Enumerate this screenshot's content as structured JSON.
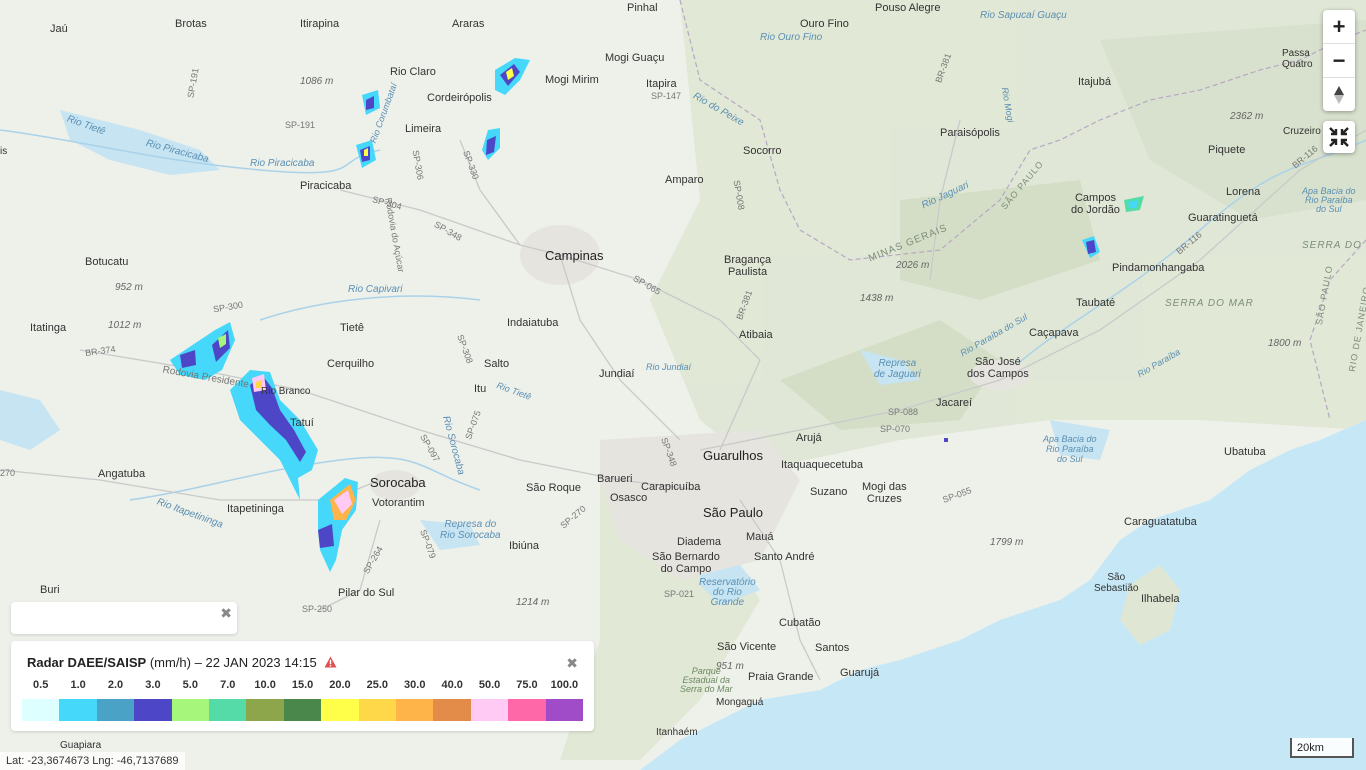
{
  "map": {
    "colors": {
      "land": "#eef0ea",
      "sea": "#c6e8f6",
      "lake": "#c6e4f2",
      "relief": "#d9e3cf",
      "road": "#c9c9c9",
      "border": "#b7a7c3"
    },
    "labels": {
      "jau": "Jaú",
      "brotas": "Brotas",
      "itirapina": "Itirapina",
      "araras": "Araras",
      "pinhal": "Pinhal",
      "mogi_guacu": "Mogi Guaçu",
      "ouro_fino": "Ouro Fino",
      "rio_ouro_fino": "Rio Ouro Fino",
      "pouso_alegre": "Pouso Alegre",
      "rio_sapucai": "Rio Sapucaí Guaçu",
      "passa_quatro": "Passa\nQuatro",
      "rio_claro": "Rio Claro",
      "mogi_mirim": "Mogi Mirim",
      "itapira": "Itapira",
      "itajuba": "Itajubá",
      "cordeiropolis": "Cordeirópolis",
      "elev_1086": "1086 m",
      "rio_tiete_1": "Rio Tietê",
      "rio_piracicaba_1": "Rio Piracicaba",
      "limeira": "Limeira",
      "rio_piracicaba_2": "Rio Piracicaba",
      "paraisopolis": "Paraisópolis",
      "cruzeiro": "Cruzeiro",
      "elev_2362": "2362 m",
      "socorro": "Socorro",
      "piquete": "Piquete",
      "piracicaba": "Piracicaba",
      "amparo": "Amparo",
      "lorena": "Lorena",
      "campos_jordao": "Campos\ndo Jordão",
      "guaratingueta": "Guaratinguetá",
      "apa_paraiba_1": "Apa Bacia do\nRio Paraíba\ndo Sul",
      "minas_gerais": "MINAS GERAIS",
      "campinas": "Campinas",
      "serra_do": "SERRA DO",
      "botucatu": "Botucatu",
      "braganca": "Bragança\nPaulista",
      "elev_2026": "2026 m",
      "pindamonhangaba": "Pindamonhangaba",
      "elev_952": "952 m",
      "rio_capivari": "Rio Capivari",
      "elev_1438": "1438 m",
      "taubate": "Taubaté",
      "serra_do_mar_1": "SERRA DO MAR",
      "itatinga": "Itatinga",
      "elev_1012": "1012 m",
      "tiete": "Tietê",
      "indaiatuba": "Indaiatuba",
      "atibaia": "Atibaia",
      "cacapava": "Caçapava",
      "elev_1800": "1800 m",
      "cerquilho": "Cerquilho",
      "sao_jose": "São José\ndos Campos",
      "salto": "Salto",
      "jundiai": "Jundiaí",
      "rio_jundiai": "Rio Jundiaí",
      "represa_jaguari": "Represa\nde Jaguari",
      "itu": "Itu",
      "rio_tiete_2": "Rio Tietê",
      "jacarei": "Jacareí",
      "rio_branco": "Rio Branco",
      "tatui": "Tatuí",
      "aruja": "Arujá",
      "apa_paraiba_2": "Apa Bacia do\nRio Paraíba\ndo Sul",
      "guarulhos": "Guarulhos",
      "itaquaquecetuba": "Itaquaquecetuba",
      "ubatuba": "Ubatuba",
      "angatuba": "Angatuba",
      "barueri": "Barueri",
      "sorocaba": "Sorocaba",
      "sao_roque": "São Roque",
      "carapicuiba": "Carapicuíba",
      "suzano": "Suzano",
      "mogi_cruzes": "Mogi das\nCruzes",
      "osasco": "Osasco",
      "votorantim": "Votorantim",
      "itapetininga": "Itapetininga",
      "sao_paulo": "São Paulo",
      "caraguatatuba": "Caraguatatuba",
      "represa_sorocaba": "Represa do\nRio Sorocaba",
      "diadema": "Diadema",
      "maua": "Mauá",
      "sao_bernardo": "São Bernardo\ndo Campo",
      "santo_andre": "Santo André",
      "ibiuna": "Ibiúna",
      "elev_1799": "1799 m",
      "reservatorio": "Reservatório\ndo Rio\nGrande",
      "sao_sebastiao": "São\nSebastião",
      "ilhabela": "Ilhabela",
      "pilar_do_sul": "Pilar do Sul",
      "buri": "Buri",
      "elev_1214": "1214 m",
      "cubatao": "Cubatão",
      "sao_vicente": "São Vicente",
      "santos": "Santos",
      "guaruja": "Guarujá",
      "elev_951": "951 m",
      "parque_serra": "Parque\nEstadual da\nSerra do Mar",
      "praia_grande": "Praia Grande",
      "mongagua": "Mongaguá",
      "itanhaem": "Itanhaém",
      "guapiara": "Guapiara",
      "sp191": "SP-191",
      "sp191b": "SP-191",
      "sp330": "SP-330",
      "sp304": "SP-304",
      "sp348": "SP-348",
      "sp306": "SP-306",
      "sp147": "SP-147",
      "sp008": "SP-008",
      "sp065": "SP-065",
      "br381": "BR-381",
      "br381b": "BR-381",
      "br116": "BR-116",
      "br116b": "BR-116",
      "sp300": "SP-300",
      "br374": "BR-374",
      "sp308": "SP-308",
      "sp075": "SP-075",
      "sp348b": "SP-348",
      "sp270": "SP-270",
      "sp280": "SP-280",
      "sp264": "SP-264",
      "sp250": "SP-250",
      "sp021": "SP-021",
      "sp079": "SP-079",
      "sp070": "SP-070",
      "sp055": "SP-055",
      "sp097": "SP-097",
      "sp088": "SP-088",
      "rodovia_presidente": "Rodovia Presidente",
      "rio_itapetininga": "Rio Itapetininga",
      "rio_sorocaba": "Rio Sorocaba",
      "rodovia_acucar": "Rodovia do Açúcar",
      "rio_jaguari": "Rio Jaguari",
      "rio_do_peixe": "Rio do Peixe",
      "rio_paraiba_1": "Rio Paraíba do Sul",
      "rio_paraiba_2": "Rio Paraíba",
      "rio_corumbatai": "Rio Corumbataí",
      "rio_mogi": "Rio Mogi",
      "sao_paulo_state": "SÃO PAULO",
      "rio_janeiro": "RIO DE JANEIRO",
      "sao_paulo_state2": "SÃO PAULO",
      "apa_serra": "Apa Bacia do\nRio Paraíba\ndo Sul",
      "sp_edge": "SP",
      "is": "is",
      "el_270": "270"
    }
  },
  "controls": {
    "zoom_in": "+",
    "zoom_out": "−",
    "reset_north": "▲"
  },
  "legend": {
    "title": "Radar DAEE/SAISP",
    "unit": "(mm/h)",
    "dash": "–",
    "datetime": "22 JAN 2023 14:15",
    "ticks": [
      "0.5",
      "1.0",
      "2.0",
      "3.0",
      "5.0",
      "7.0",
      "10.0",
      "15.0",
      "20.0",
      "25.0",
      "30.0",
      "40.0",
      "50.0",
      "75.0",
      "100.0"
    ],
    "colors": [
      "#ddffff",
      "#45d8fa",
      "#4aa2c7",
      "#4d47c8",
      "#a7f67c",
      "#55dba8",
      "#8da64b",
      "#4a874b",
      "#ffff4a",
      "#ffd84a",
      "#ffb44a",
      "#e38c4a",
      "#ffcbf5",
      "#ff68a8",
      "#a04cc8"
    ],
    "close": "✖"
  },
  "small_panel": {
    "close": "✖"
  },
  "status": {
    "lat_label": "Lat:",
    "lat": "-23,3674673",
    "lng_label": "Lng:",
    "lng": "-46,7137689"
  },
  "scale": {
    "label": "20km"
  }
}
